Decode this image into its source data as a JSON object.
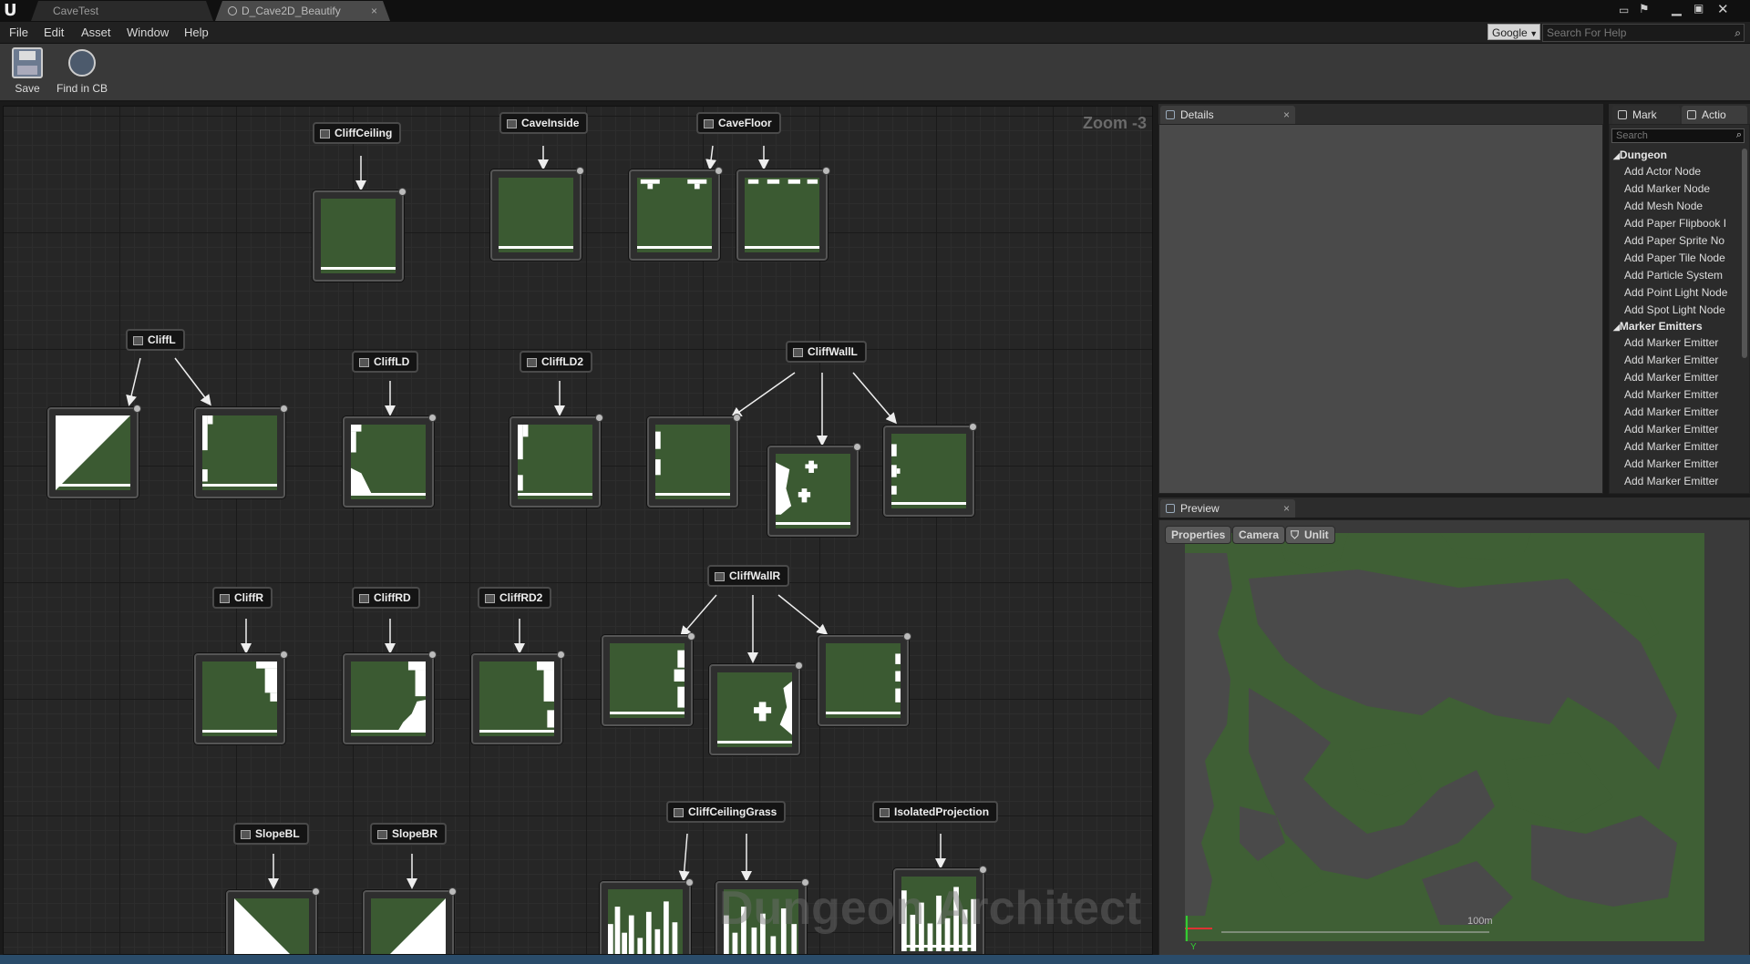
{
  "titlebar": {
    "tabs": [
      {
        "label": "CaveTest",
        "active": false
      },
      {
        "label": "D_Cave2D_Beautify",
        "active": true
      }
    ],
    "logo": "unreal-logo"
  },
  "menubar": {
    "items": [
      "File",
      "Edit",
      "Asset",
      "Window",
      "Help"
    ],
    "search_engine": "Google",
    "search_placeholder": "Search For Help"
  },
  "toolbar": {
    "buttons": [
      {
        "label": "Save",
        "icon": "floppy-disk-icon"
      },
      {
        "label": "Find in CB",
        "icon": "magnifier-icon"
      }
    ]
  },
  "graph": {
    "zoom": "Zoom -3",
    "watermark": "Dungeon Architect",
    "nodes": {
      "CliffCeiling": "CliffCeiling",
      "CaveInside": "CaveInside",
      "CaveFloor": "CaveFloor",
      "CliffL": "CliffL",
      "CliffLD": "CliffLD",
      "CliffLD2": "CliffLD2",
      "CliffWallL": "CliffWallL",
      "CliffR": "CliffR",
      "CliffRD": "CliffRD",
      "CliffRD2": "CliffRD2",
      "CliffWallR": "CliffWallR",
      "SlopeBL": "SlopeBL",
      "SlopeBR": "SlopeBR",
      "CliffCeilingGrass": "CliffCeilingGrass",
      "IsolatedProjection": "IsolatedProjection"
    }
  },
  "details": {
    "tab": "Details"
  },
  "actions": {
    "tabs": [
      "Mark",
      "Actio"
    ],
    "search_placeholder": "Search",
    "categories": [
      {
        "name": "Dungeon",
        "items": [
          "Add Actor Node",
          "Add Marker Node",
          "Add Mesh Node",
          "Add Paper Flipbook I",
          "Add Paper Sprite No",
          "Add Paper Tile Node",
          "Add Particle System",
          "Add Point Light Node",
          "Add Spot Light Node"
        ]
      },
      {
        "name": "Marker Emitters",
        "items": [
          "Add Marker Emitter",
          "Add Marker Emitter",
          "Add Marker Emitter",
          "Add Marker Emitter",
          "Add Marker Emitter",
          "Add Marker Emitter",
          "Add Marker Emitter",
          "Add Marker Emitter",
          "Add Marker Emitter"
        ]
      }
    ]
  },
  "preview": {
    "tab": "Preview",
    "buttons": [
      "Properties",
      "Camera",
      "Unlit"
    ],
    "scale_label": "100m",
    "axis_y": "Y",
    "colors": {
      "ground": "#3f5f35",
      "cave": "#4a4a4a"
    }
  }
}
